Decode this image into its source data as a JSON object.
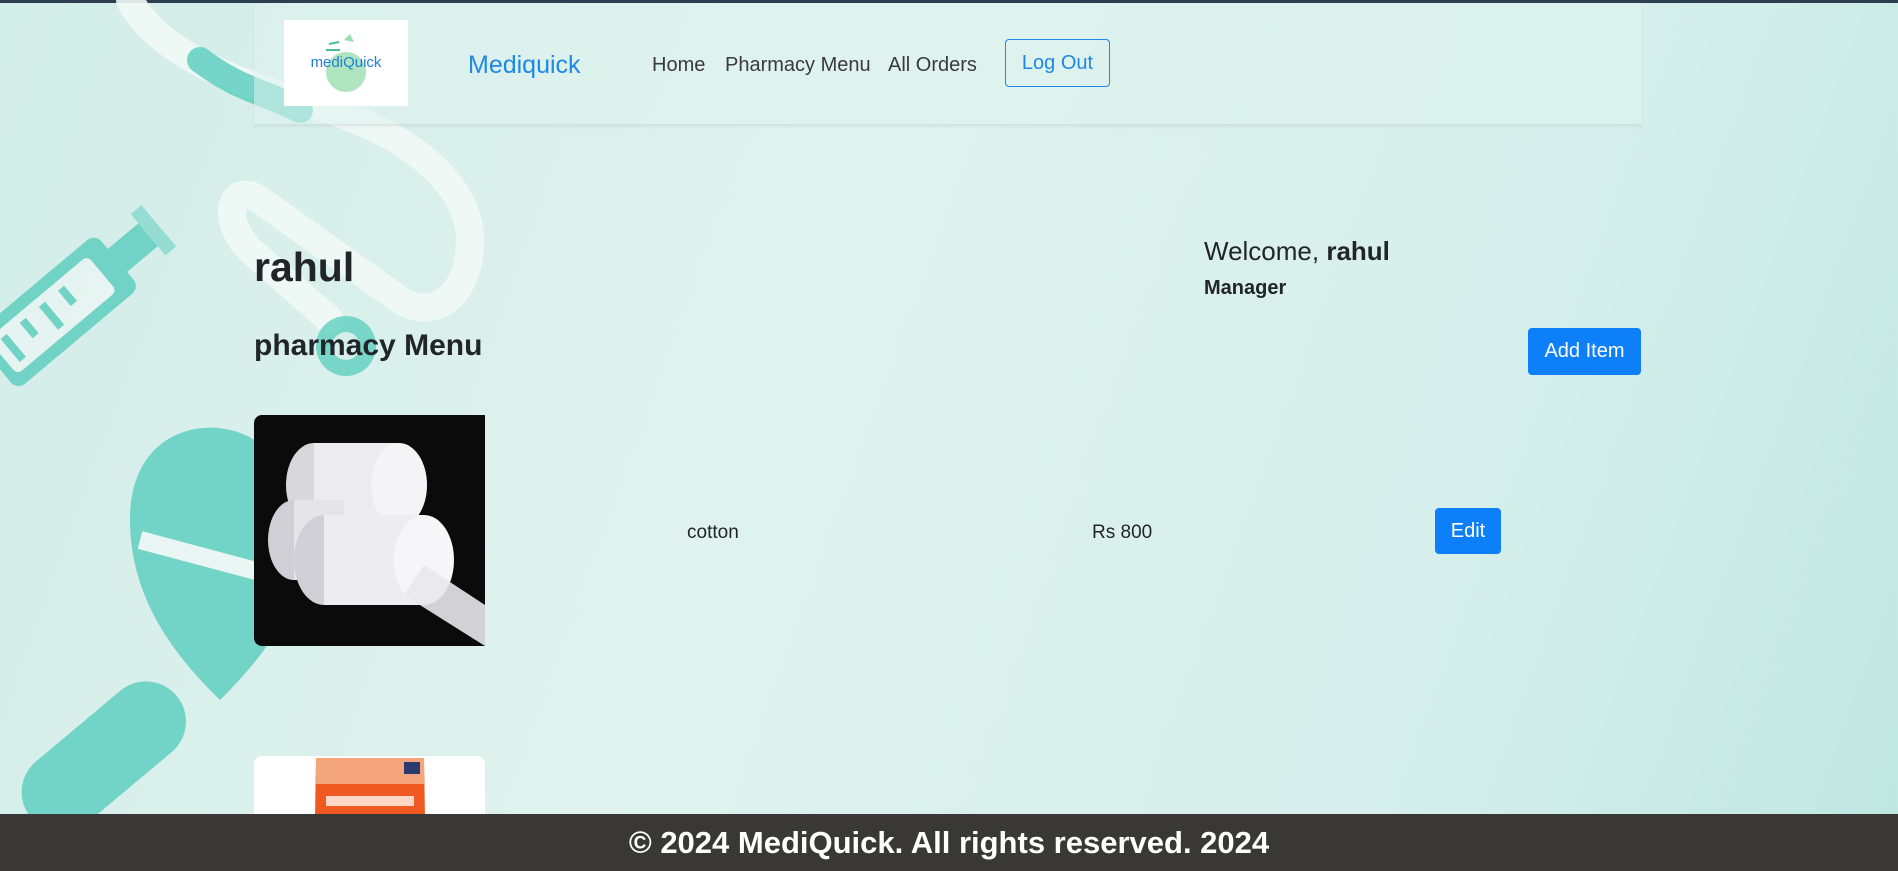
{
  "colors": {
    "accent": "#0d7ff9",
    "brand": "#1e88e5",
    "footer_bg": "#3a3836",
    "teal": "#5fcfbf"
  },
  "navbar": {
    "logo_text": "mediQuick",
    "brand": "Mediquick",
    "links": [
      {
        "label": "Home"
      },
      {
        "label": "Pharmacy Menu"
      },
      {
        "label": "All Orders"
      }
    ],
    "logout_label": "Log Out"
  },
  "profile": {
    "name": "rahul",
    "welcome_prefix": "Welcome, ",
    "welcome_name": "rahul",
    "role": "Manager"
  },
  "menu": {
    "title": "pharmacy Menu",
    "add_label": "Add Item",
    "items": [
      {
        "name": "cotton",
        "price": "Rs 800",
        "edit_label": "Edit"
      }
    ]
  },
  "footer": {
    "text": "© 2024 MediQuick. All rights reserved. 2024"
  }
}
